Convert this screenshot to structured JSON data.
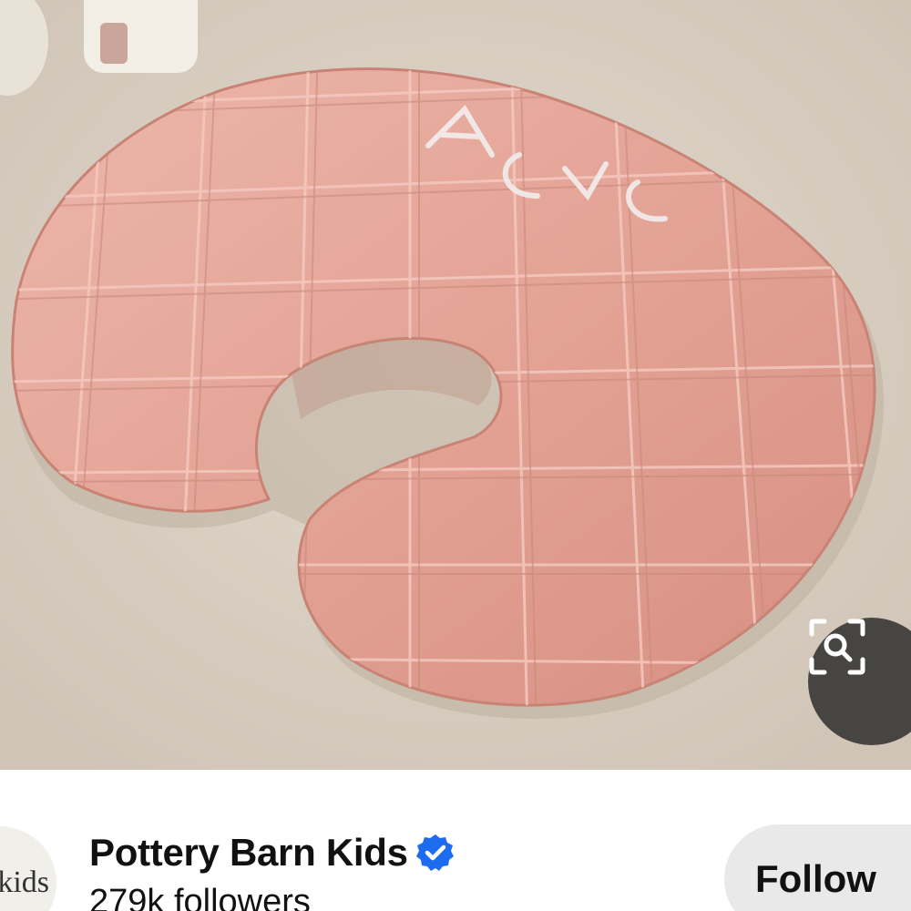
{
  "pin": {
    "image_description_icon": "nursing-pillow-photo",
    "visual_search_icon": "visual-search-icon",
    "pillow_color": "#e3a59b",
    "background_color": "#ddd3c6"
  },
  "creator": {
    "avatar_text": "kids",
    "name": "Pottery Barn Kids",
    "verified_icon": "verified-badge-icon",
    "verified_color": "#1d6cf0",
    "followers": "279k followers",
    "follow_label": "Follow"
  }
}
